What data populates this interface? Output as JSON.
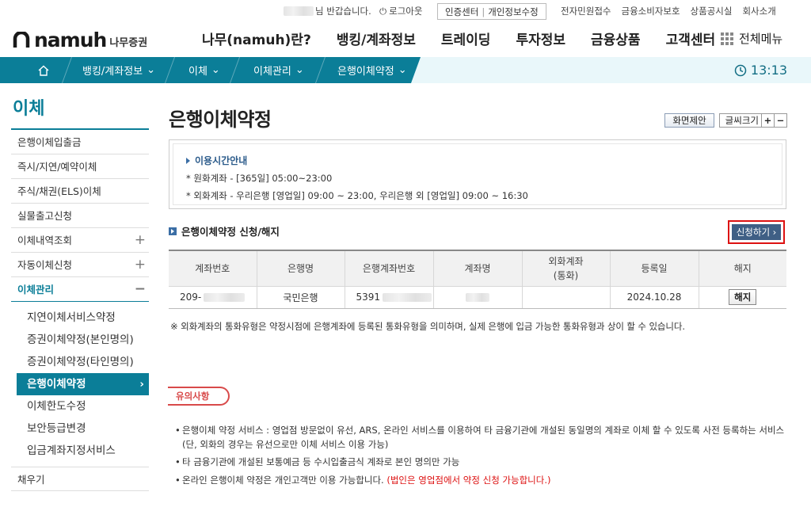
{
  "util": {
    "greeting": "님 반갑습니다.",
    "logout": "로그아웃",
    "cert_center": "인증센터",
    "privacy": "개인정보수정",
    "links": [
      "전자민원접수",
      "금융소비자보호",
      "상품공시실",
      "회사소개"
    ]
  },
  "brand": {
    "name_en": "namuh",
    "name_ko": "나무증권"
  },
  "gnb": {
    "items": [
      "나무(namuh)란?",
      "뱅킹/계좌정보",
      "트레이딩",
      "투자정보",
      "금융상품",
      "고객센터"
    ],
    "all_menu": "전체메뉴"
  },
  "lnb": {
    "crumbs": [
      "뱅킹/계좌정보",
      "이체",
      "이체관리",
      "은행이체약정"
    ],
    "time": "13:13"
  },
  "side": {
    "title": "이체",
    "items": [
      {
        "label": "은행이체입출금"
      },
      {
        "label": "즉시/지연/예약이체"
      },
      {
        "label": "주식/채권(ELS)이체"
      },
      {
        "label": "실물출고신청"
      },
      {
        "label": "이체내역조회",
        "toggle": "+"
      },
      {
        "label": "자동이체신청",
        "toggle": "+"
      },
      {
        "label": "이체관리",
        "toggle": "−"
      }
    ],
    "subs": [
      "지연이체서비스약정",
      "증권이체약정(본인명의)",
      "증권이체약정(타인명의)",
      "은행이체약정",
      "이체한도수정",
      "보안등급변경",
      "입금계좌지정서비스"
    ],
    "last": "채우기"
  },
  "main": {
    "title": "은행이체약정",
    "btn_suggest": "화면제안",
    "btn_font": "글씨크기",
    "info_title": "이용시간안내",
    "info_lines": [
      "* 원화계좌 - [365일] 05:00~23:00",
      "* 외화계좌 - 우리은행 [영업일] 09:00 ~ 23:00, 우리은행 외 [영업일] 09:00 ~ 16:30"
    ],
    "section_title": "은행이체약정 신청/해지",
    "apply_btn": "신청하기 ›",
    "table": {
      "headers": [
        "계좌번호",
        "은행명",
        "은행계좌번호",
        "계좌명",
        "외화계좌\n(통화)",
        "등록일",
        "해지"
      ],
      "row": {
        "account": "209-",
        "bank": "국민은행",
        "bank_account": "5391",
        "account_name": "",
        "currency": "",
        "date": "2024.10.28",
        "cancel": "해지"
      }
    },
    "note": "※ 외화계좌의 통화유형은 약정시점에 은행계좌에 등록된 통화유형을 의미하며, 실제 은행에 입금 가능한 통화유형과 상이 할 수 있습니다.",
    "caution": "유의사항",
    "bullets": [
      "은행이체 약정 서비스 : 영업점 방문없이 유선, ARS, 온라인 서비스를 이용하여 타 금융기관에 개설된 동일명의 계좌로 이체 할 수 있도록 사전 등록하는 서비스(단, 외화의 경우는 유선으로만 이체 서비스 이용 가능)",
      "타 금융기관에 개설된 보통예금 등 수시입출금식 계좌로 본인 명의만 가능",
      "온라인 은행이체 약정은 개인고객만 이용 가능합니다."
    ],
    "bullet3_red": "(법인은 영업점에서 약정 신청 가능합니다.)"
  }
}
